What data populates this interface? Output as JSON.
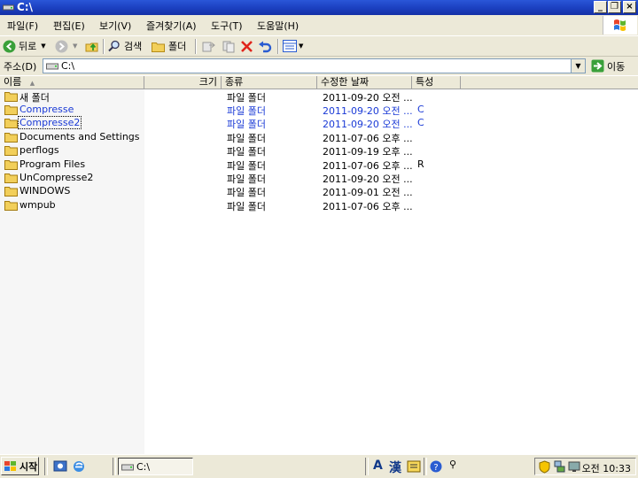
{
  "window": {
    "title": "C:\\"
  },
  "menu": [
    "파일(F)",
    "편집(E)",
    "보기(V)",
    "즐겨찾기(A)",
    "도구(T)",
    "도움말(H)"
  ],
  "toolbar": {
    "back": "뒤로",
    "search": "검색",
    "folders": "폴더"
  },
  "address": {
    "label": "주소(D)",
    "value": "C:\\",
    "go": "이동"
  },
  "columns": {
    "name": "이름",
    "size": "크기",
    "type": "종류",
    "modified": "수정한 날짜",
    "attr": "특성"
  },
  "files": [
    {
      "name": "새 폴더",
      "type": "파일 폴더",
      "modified": "2011-09-20 오전 ...",
      "attr": ""
    },
    {
      "name": "Compresse",
      "type": "파일 폴더",
      "modified": "2011-09-20 오전 ...",
      "attr": "C"
    },
    {
      "name": "Compresse2",
      "type": "파일 폴더",
      "modified": "2011-09-20 오전 ...",
      "attr": "C"
    },
    {
      "name": "Documents and Settings",
      "type": "파일 폴더",
      "modified": "2011-07-06 오후 ...",
      "attr": ""
    },
    {
      "name": "perflogs",
      "type": "파일 폴더",
      "modified": "2011-09-19 오후 ...",
      "attr": ""
    },
    {
      "name": "Program Files",
      "type": "파일 폴더",
      "modified": "2011-07-06 오후 ...",
      "attr": "R"
    },
    {
      "name": "UnCompresse2",
      "type": "파일 폴더",
      "modified": "2011-09-20 오전 ...",
      "attr": ""
    },
    {
      "name": "WINDOWS",
      "type": "파일 폴더",
      "modified": "2011-09-01 오전 ...",
      "attr": ""
    },
    {
      "name": "wmpub",
      "type": "파일 폴더",
      "modified": "2011-07-06 오후 ...",
      "attr": ""
    }
  ],
  "taskbar": {
    "start": "시작",
    "task": "C:\\",
    "ime_a": "A",
    "ime_han": "漢",
    "clock": "오전 10:33"
  },
  "colors": {
    "titlebar": "#1b3fbf",
    "compressed_text": "#1a3ad6",
    "chrome": "#ece9d8"
  }
}
